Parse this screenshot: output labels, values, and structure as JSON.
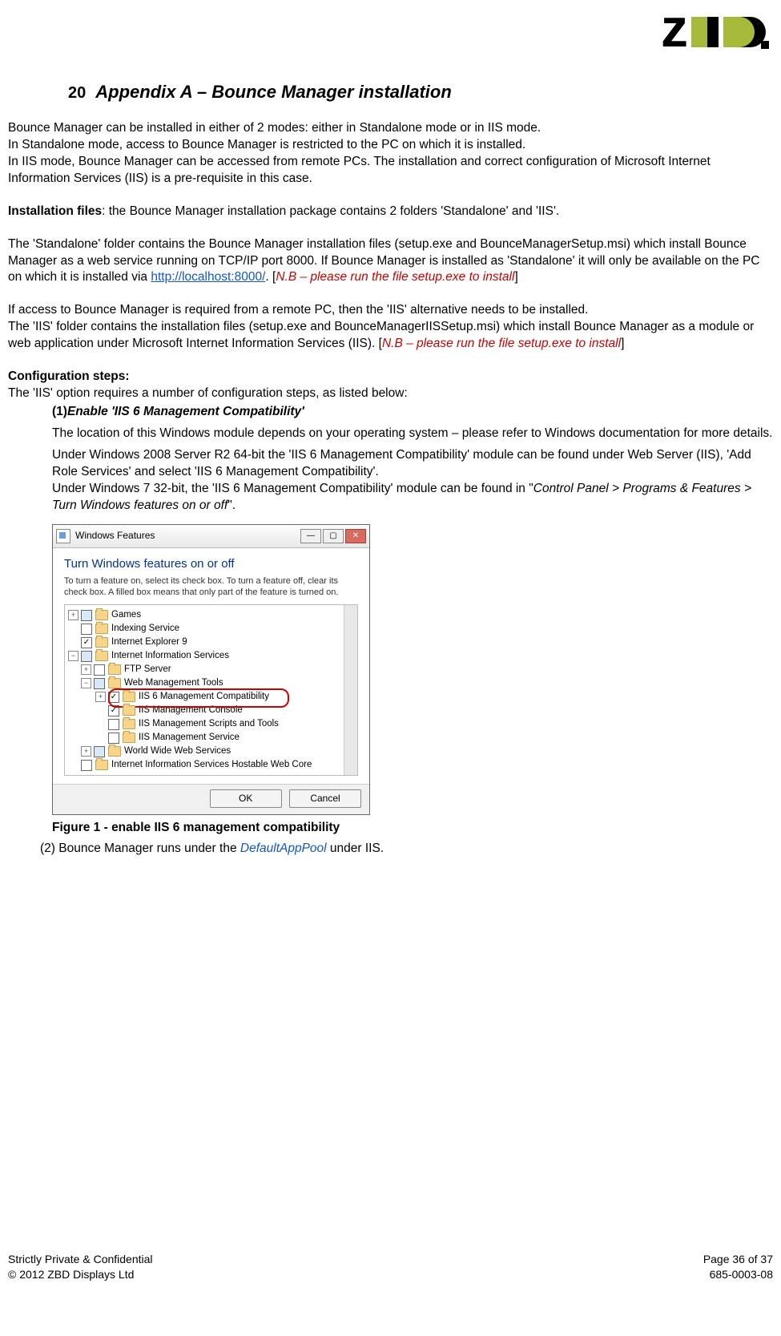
{
  "logo_text": "zbd",
  "section": {
    "num": "20",
    "title": "Appendix A – Bounce Manager installation"
  },
  "p1": "Bounce Manager can be installed in either of 2 modes: either in Standalone mode or in IIS mode.",
  "p2": "In Standalone mode, access to Bounce Manager is restricted to the PC on which it is installed.",
  "p3": "In IIS mode, Bounce Manager can be accessed from remote PCs.  The installation and correct configuration of Microsoft Internet Information Services (IIS) is a pre-requisite in this case.",
  "p4a": "Installation files",
  "p4b": ": the Bounce Manager installation package contains 2 folders 'Standalone' and 'IIS'.",
  "p5a": "The 'Standalone' folder contains the Bounce Manager installation files (setup.exe and BounceManagerSetup.msi) which install Bounce Manager as a web service running on TCP/IP port 8000.  If Bounce Manager is installed as 'Standalone' it will only be available on the PC on which it is installed via ",
  "p5_link": "http://localhost:8000/",
  "p5b": ". [",
  "p5_nb": "N.B – please run the file setup.exe to install",
  "p5c": "]",
  "p6": "If access to Bounce Manager is required from a remote PC, then the 'IIS' alternative needs to be installed.",
  "p7a": "The 'IIS' folder contains the installation files (setup.exe and BounceManagerIISSetup.msi) which install Bounce Manager as a module or web application under Microsoft Internet Information Services (IIS). [",
  "p7_nb": "N.B – please run the file setup.exe to install",
  "p7b": "]",
  "cfg_head": "Configuration steps:",
  "cfg_intro": "The 'IIS' option requires a number of configuration steps, as listed below:",
  "step1_num": "(1)",
  "step1_title": "Enable 'IIS 6 Management Compatibility'",
  "step1_p1": "The location of this Windows module depends on your operating system – please refer to Windows documentation for more details.",
  "step1_p2": "Under Windows 2008 Server R2 64-bit the 'IIS 6 Management Compatibility' module can be found under Web Server (IIS), 'Add Role Services' and select 'IIS 6 Management Compatibility'.",
  "step1_p3a": "Under Windows 7 32-bit, the 'IIS 6 Management Compatibility' module can be found in \"",
  "step1_p3_i": "Control Panel > Programs & Features > Turn Windows features on or off",
  "step1_p3b": "\".",
  "dlg": {
    "title": "Windows Features",
    "head": "Turn Windows features on or off",
    "sub": "To turn a feature on, select its check box. To turn a feature off, clear its check box. A filled box means that only part of the feature is turned on.",
    "ok": "OK",
    "cancel": "Cancel",
    "tree": {
      "games": "Games",
      "index": "Indexing Service",
      "ie9": "Internet Explorer 9",
      "iis": "Internet Information Services",
      "ftp": "FTP Server",
      "wmt": "Web Management Tools",
      "iis6": "IIS 6 Management Compatibility",
      "console": "IIS Management Console",
      "scripts": "IIS Management Scripts and Tools",
      "svc": "IIS Management Service",
      "www": "World Wide Web Services",
      "hostable": "Internet Information Services Hostable Web Core"
    }
  },
  "fig_caption": "Figure 1 - enable IIS 6 management compatibility",
  "step2_num": "(2)",
  "step2_a": " Bounce Manager runs under the ",
  "step2_i": "DefaultAppPool",
  "step2_b": " under IIS.",
  "footer": {
    "l1": "Strictly Private & Confidential",
    "l2": "© 2012 ZBD Displays Ltd",
    "r1": "Page 36 of 37",
    "r2": "685-0003-08"
  }
}
